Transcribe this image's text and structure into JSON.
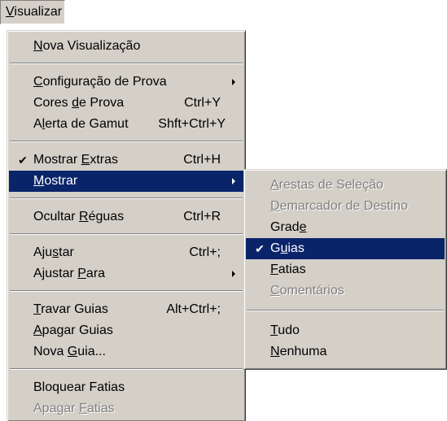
{
  "menubar": {
    "title_pre": "",
    "title_ul": "V",
    "title_post": "isualizar"
  },
  "main_menu": {
    "nova_visualizacao": {
      "pre": "",
      "ul": "N",
      "post": "ova Visualização"
    },
    "configuracao_prova": {
      "pre": "",
      "ul": "C",
      "post": "onfiguração de Prova"
    },
    "cores_prova": {
      "pre": "Cores ",
      "ul": "d",
      "post": "e Prova",
      "shortcut": "Ctrl+Y"
    },
    "alerta_gamut": {
      "pre": "A",
      "ul": "l",
      "post": "erta de Gamut",
      "shortcut": "Shft+Ctrl+Y"
    },
    "mostrar_extras": {
      "pre": "Mostrar ",
      "ul": "E",
      "post": "xtras",
      "shortcut": "Ctrl+H",
      "checked": "✔"
    },
    "mostrar": {
      "pre": "",
      "ul": "M",
      "post": "ostrar"
    },
    "ocultar_reguas": {
      "pre": "Ocultar ",
      "ul": "R",
      "post": "éguas",
      "shortcut": "Ctrl+R"
    },
    "ajustar": {
      "pre": "Aju",
      "ul": "s",
      "post": "tar",
      "shortcut": "Ctrl+;"
    },
    "ajustar_para": {
      "pre": "Ajustar ",
      "ul": "P",
      "post": "ara"
    },
    "travar_guias": {
      "pre": "",
      "ul": "T",
      "post": "ravar Guias",
      "shortcut": "Alt+Ctrl+;"
    },
    "apagar_guias": {
      "pre": "",
      "ul": "A",
      "post": "pagar Guias"
    },
    "nova_guia": {
      "pre": "Nova ",
      "ul": "G",
      "post": "uia..."
    },
    "bloquear_fatias": {
      "pre": "Bloquear Fatias",
      "ul": "",
      "post": ""
    },
    "apagar_fatias": {
      "pre": "Apagar ",
      "ul": "F",
      "post": "atias"
    }
  },
  "sub_menu": {
    "arestas_selecao": {
      "pre": "",
      "ul": "A",
      "post": "restas de Seleção"
    },
    "demarcador_destino": {
      "pre": "",
      "ul": "D",
      "post": "emarcador de Destino"
    },
    "grade": {
      "pre": "Grad",
      "ul": "e",
      "post": ""
    },
    "guias": {
      "pre": "G",
      "ul": "u",
      "post": "ias",
      "checked": "✔"
    },
    "fatias": {
      "pre": "",
      "ul": "F",
      "post": "atias"
    },
    "comentarios": {
      "pre": "",
      "ul": "C",
      "post": "omentários"
    },
    "tudo": {
      "pre": "",
      "ul": "T",
      "post": "udo"
    },
    "nenhuma": {
      "pre": "",
      "ul": "N",
      "post": "enhuma"
    }
  },
  "colors": {
    "menu_face": "#d4d0c8",
    "highlight": "#0a246a",
    "disabled_text": "#808080"
  }
}
